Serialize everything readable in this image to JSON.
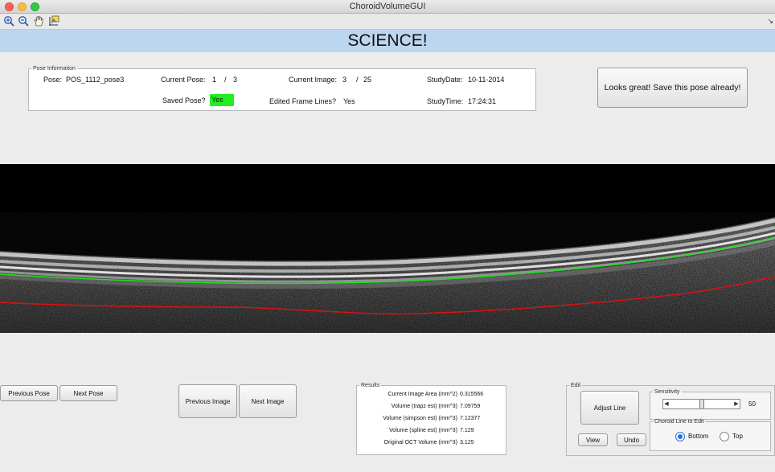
{
  "window": {
    "title": "ChoroidVolumeGUI"
  },
  "toolbar": {
    "icons": [
      "zoom-in-icon",
      "zoom-out-icon",
      "pan-hand-icon",
      "data-cursor-icon"
    ]
  },
  "banner": {
    "title": "SCIENCE!"
  },
  "pose_info": {
    "legend": "Pose Information",
    "pose_label": "Pose:",
    "pose_value": "POS_1112_pose3",
    "current_pose_label": "Current Pose:",
    "current_pose": "1",
    "pose_sep": "/",
    "pose_total": "3",
    "current_image_label": "Current Image:",
    "current_image": "3",
    "image_sep": "/",
    "image_total": "25",
    "study_date_label": "StudyDate:",
    "study_date": "10-11-2014",
    "saved_pose_label": "Saved Pose?",
    "saved_pose": "Yes",
    "edited_lines_label": "Edited Frame Lines?",
    "edited_lines": "Yes",
    "study_time_label": "StudyTime:",
    "study_time": "17:24:31"
  },
  "buttons": {
    "save_pose": "Looks great! Save this pose already!",
    "previous_pose": "Previous Pose",
    "next_pose": "Next Pose",
    "previous_image": "Previous Image",
    "next_image": "Next Image",
    "adjust_line": "Adjust Line",
    "view": "View",
    "undo": "Undo"
  },
  "results": {
    "legend": "Results",
    "rows": [
      {
        "label": "Current Image Area (mm^2)",
        "value": "0.315566"
      },
      {
        "label": "Volume (trapz est) (mm^3)",
        "value": "7.09759"
      },
      {
        "label": "Volume (simpson est) (mm^3)",
        "value": "7.12377"
      },
      {
        "label": "Volume (spline est) (mm^3)",
        "value": "7.129"
      },
      {
        "label": "Original OCT Volume (mm^3)",
        "value": "3.125"
      }
    ]
  },
  "edit": {
    "legend": "Edit",
    "sensitivity_legend": "Sensitivity",
    "sensitivity_value": "50",
    "sensitivity_fraction": 0.5,
    "choroid_legend": "Choroid Line to Edit",
    "options": [
      "Bottom",
      "Top"
    ],
    "selected": "Bottom"
  },
  "oct_image": {
    "upper_line_color": "#22dd22",
    "lower_line_color": "#dd1111"
  }
}
